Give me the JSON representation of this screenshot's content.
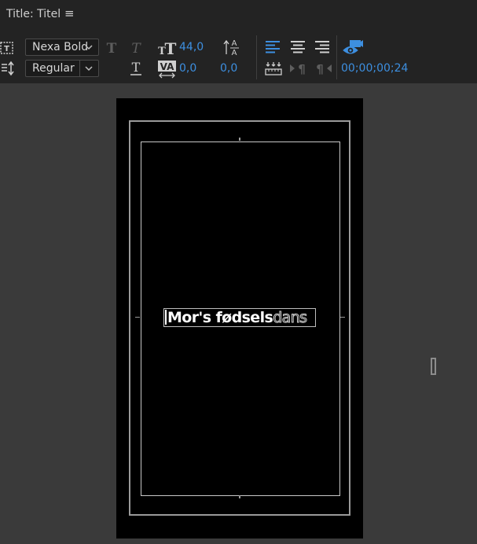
{
  "window": {
    "title": "Title: Titel",
    "menu_icon": "hamburger-menu-icon"
  },
  "toolbar": {
    "font_family": "Nexa Bold",
    "font_style": "Regular",
    "font_size": "44,0",
    "kerning": "0,0",
    "tracking": "0,0",
    "timecode": "00;00;00;24",
    "icons": [
      "text-tool-icon",
      "leading-icon",
      "faux-bold-icon",
      "faux-italic-icon",
      "underline-icon",
      "font-size-icon",
      "kerning-icon",
      "tracking-icon",
      "align-left-icon",
      "align-center-icon",
      "align-right-icon",
      "tab-stops-icon",
      "show-background-video-icon"
    ],
    "colors": {
      "accent": "#3d8fe0",
      "panel": "#232323",
      "stage": "#3a3a3a"
    }
  },
  "canvas": {
    "text_selected": "Mor's fødsels",
    "text_unselected": "dans"
  }
}
